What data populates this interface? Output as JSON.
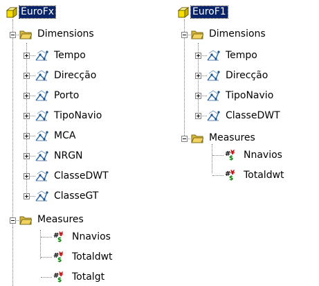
{
  "trees": [
    {
      "root_label": "EuroFx",
      "dimensions_label": "Dimensions",
      "dimensions": [
        "Tempo",
        "Direcção",
        "Porto",
        "TipoNavio",
        "MCA",
        "NRGN",
        "ClasseDWT",
        "ClasseGT"
      ],
      "measures_label": "Measures",
      "measures": [
        "Nnavios",
        "Totaldwt",
        "Totalgt"
      ]
    },
    {
      "root_label": "EuroF1",
      "dimensions_label": "Dimensions",
      "dimensions": [
        "Tempo",
        "Direcção",
        "TipoNavio",
        "ClasseDWT"
      ],
      "measures_label": "Measures",
      "measures": [
        "Nnavios",
        "Totaldwt"
      ]
    }
  ],
  "icons": {
    "cube": "cube-icon",
    "folder": "folder-icon",
    "dimension": "dimension-icon",
    "measure": "measure-icon",
    "expand": "expand-plus-icon",
    "collapse": "collapse-minus-icon"
  },
  "colors": {
    "selection": "#0a246a",
    "cube_yellow": "#f7e000",
    "folder": "#f3d35f"
  }
}
